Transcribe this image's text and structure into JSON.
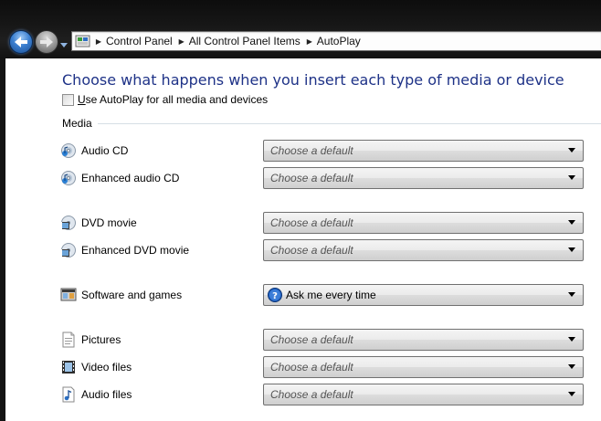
{
  "window": {
    "breadcrumbs": [
      "Control Panel",
      "All Control Panel Items",
      "AutoPlay"
    ]
  },
  "page": {
    "title": "Choose what happens when you insert each type of media or device",
    "autoplay_checkbox": {
      "label_underlined": "U",
      "label_rest": "se AutoPlay for all media and devices",
      "checked": false
    },
    "group_label": "Media"
  },
  "media": [
    {
      "label": "Audio CD",
      "icon": "audio-cd-icon",
      "value": "Choose a default",
      "is_placeholder": true
    },
    {
      "label": "Enhanced audio CD",
      "icon": "enhanced-audio-cd-icon",
      "value": "Choose a default",
      "is_placeholder": true
    },
    {
      "label": "DVD movie",
      "icon": "dvd-movie-icon",
      "value": "Choose a default",
      "is_placeholder": true
    },
    {
      "label": "Enhanced DVD movie",
      "icon": "enhanced-dvd-movie-icon",
      "value": "Choose a default",
      "is_placeholder": true
    },
    {
      "label": "Software and games",
      "icon": "software-games-icon",
      "value": "Ask me every time",
      "is_placeholder": false,
      "value_icon": "question-icon"
    },
    {
      "label": "Pictures",
      "icon": "pictures-icon",
      "value": "Choose a default",
      "is_placeholder": true
    },
    {
      "label": "Video files",
      "icon": "video-files-icon",
      "value": "Choose a default",
      "is_placeholder": true
    },
    {
      "label": "Audio files",
      "icon": "audio-files-icon",
      "value": "Choose a default",
      "is_placeholder": true
    }
  ],
  "colors": {
    "title": "#1e3287",
    "placeholder_text": "#555555"
  }
}
